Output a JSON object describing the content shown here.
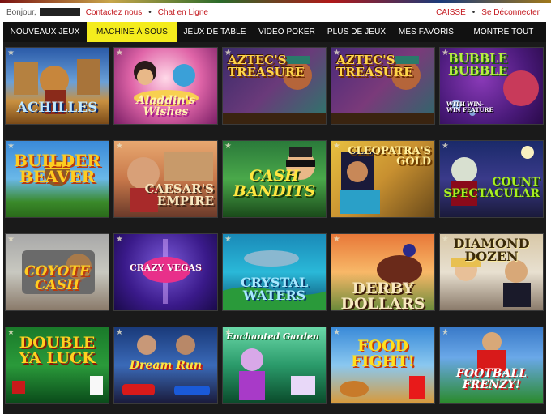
{
  "topbar": {
    "greeting": "Bonjour,",
    "contact": "Contactez nous",
    "chat": "Chat en Ligne",
    "cashier": "CAISSE",
    "logout": "Se Déconnecter",
    "bullet": "•"
  },
  "nav": {
    "items": [
      {
        "label": "NOUVEAUX JEUX"
      },
      {
        "label": "MACHINE À SOUS"
      },
      {
        "label": "JEUX DE TABLE"
      },
      {
        "label": "VIDEO POKER"
      },
      {
        "label": "PLUS DE JEUX"
      },
      {
        "label": "MES FAVORIS"
      },
      {
        "label": "MONTRE TOUT"
      }
    ],
    "active_index": 1,
    "active_color": "#f4ec1d"
  },
  "games": [
    {
      "title": "ACHILLES"
    },
    {
      "title": "Aladdin's Wishes"
    },
    {
      "title": "AZTEC'S TREASURE"
    },
    {
      "title": "AZTEC'S TREASURE"
    },
    {
      "title": "BUBBLE BUBBLE",
      "subtitle": "WITH WIN-WIN FEATURE"
    },
    {
      "title": "BUILDER BEAVER"
    },
    {
      "title": "CAESAR'S EMPIRE"
    },
    {
      "title": "CASH BANDITS"
    },
    {
      "title": "CLEOPATRA'S GOLD"
    },
    {
      "title": "COUNT SPECTACULAR"
    },
    {
      "title": "COYOTE CASH"
    },
    {
      "title": "CRAZY VEGAS"
    },
    {
      "title": "CRYSTAL WATERS"
    },
    {
      "title": "DERBY DOLLARS"
    },
    {
      "title": "DIAMOND DOZEN"
    },
    {
      "title": "DOUBLE YA LUCK"
    },
    {
      "title": "Dream Run"
    },
    {
      "title": "Enchanted Garden"
    },
    {
      "title": "FOOD FIGHT!"
    },
    {
      "title": "FOOTBALL FRENZY!"
    }
  ],
  "colors": {
    "brand_red": "#c3161c",
    "nav_bg": "#111111",
    "title_gold": "#ffd54a"
  }
}
